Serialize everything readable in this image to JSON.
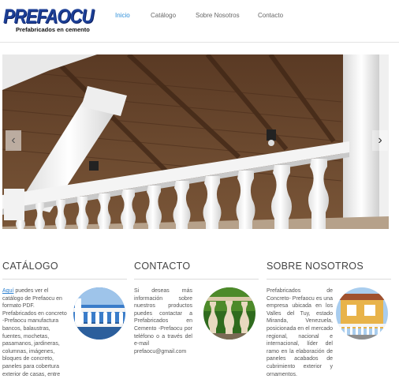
{
  "brand": {
    "name": "Prefaocu",
    "logo_text": "PREFAOCU",
    "tagline": "Prefabricados en cemento"
  },
  "nav": {
    "items": [
      {
        "label": "Inicio",
        "active": true
      },
      {
        "label": "Catálogo",
        "active": false
      },
      {
        "label": "Sobre Nosotros",
        "active": false
      },
      {
        "label": "Contacto",
        "active": false
      }
    ],
    "active_color": "#2e8fd9"
  },
  "slider": {
    "prev_icon": "‹",
    "next_icon": "›"
  },
  "sections": {
    "catalogo": {
      "title": "CATÁLOGO",
      "link_text": "Aquí",
      "text_line1": " puedes ver el",
      "text_line2": "catálogo de Prefaocu en formato PDF. Prefabricados en concreto -Prefaocu manufactura bancos, balaustras, fuentes, mochetas, pasamanos, jardineras, columnas, imágenes, bloques de concreto, paneles para cobertura exterior de casas, entre otros."
    },
    "contacto": {
      "title": "CONTACTO",
      "text": "Si deseas más información sobre nuestros productos puedes contactar a Prefabricados en Cemento -Prefaocu por teléfono o a través del e-mail prefaocu@gmail.com"
    },
    "sobre": {
      "title": "SOBRE NOSOTROS",
      "text": "Prefabricados de Concreto- Prefaocu es una empresa ubicada en los Valles del Tuy, estado Miranda, Venezuela, posicionada en el mercado regional, nacional e internacional, líder del ramo en la elaboración de paneles acabados de cubrimiento exterior y ornamentos."
    }
  },
  "colors": {
    "link": "#2a7fd0",
    "logo_blue": "#1c3f96"
  }
}
